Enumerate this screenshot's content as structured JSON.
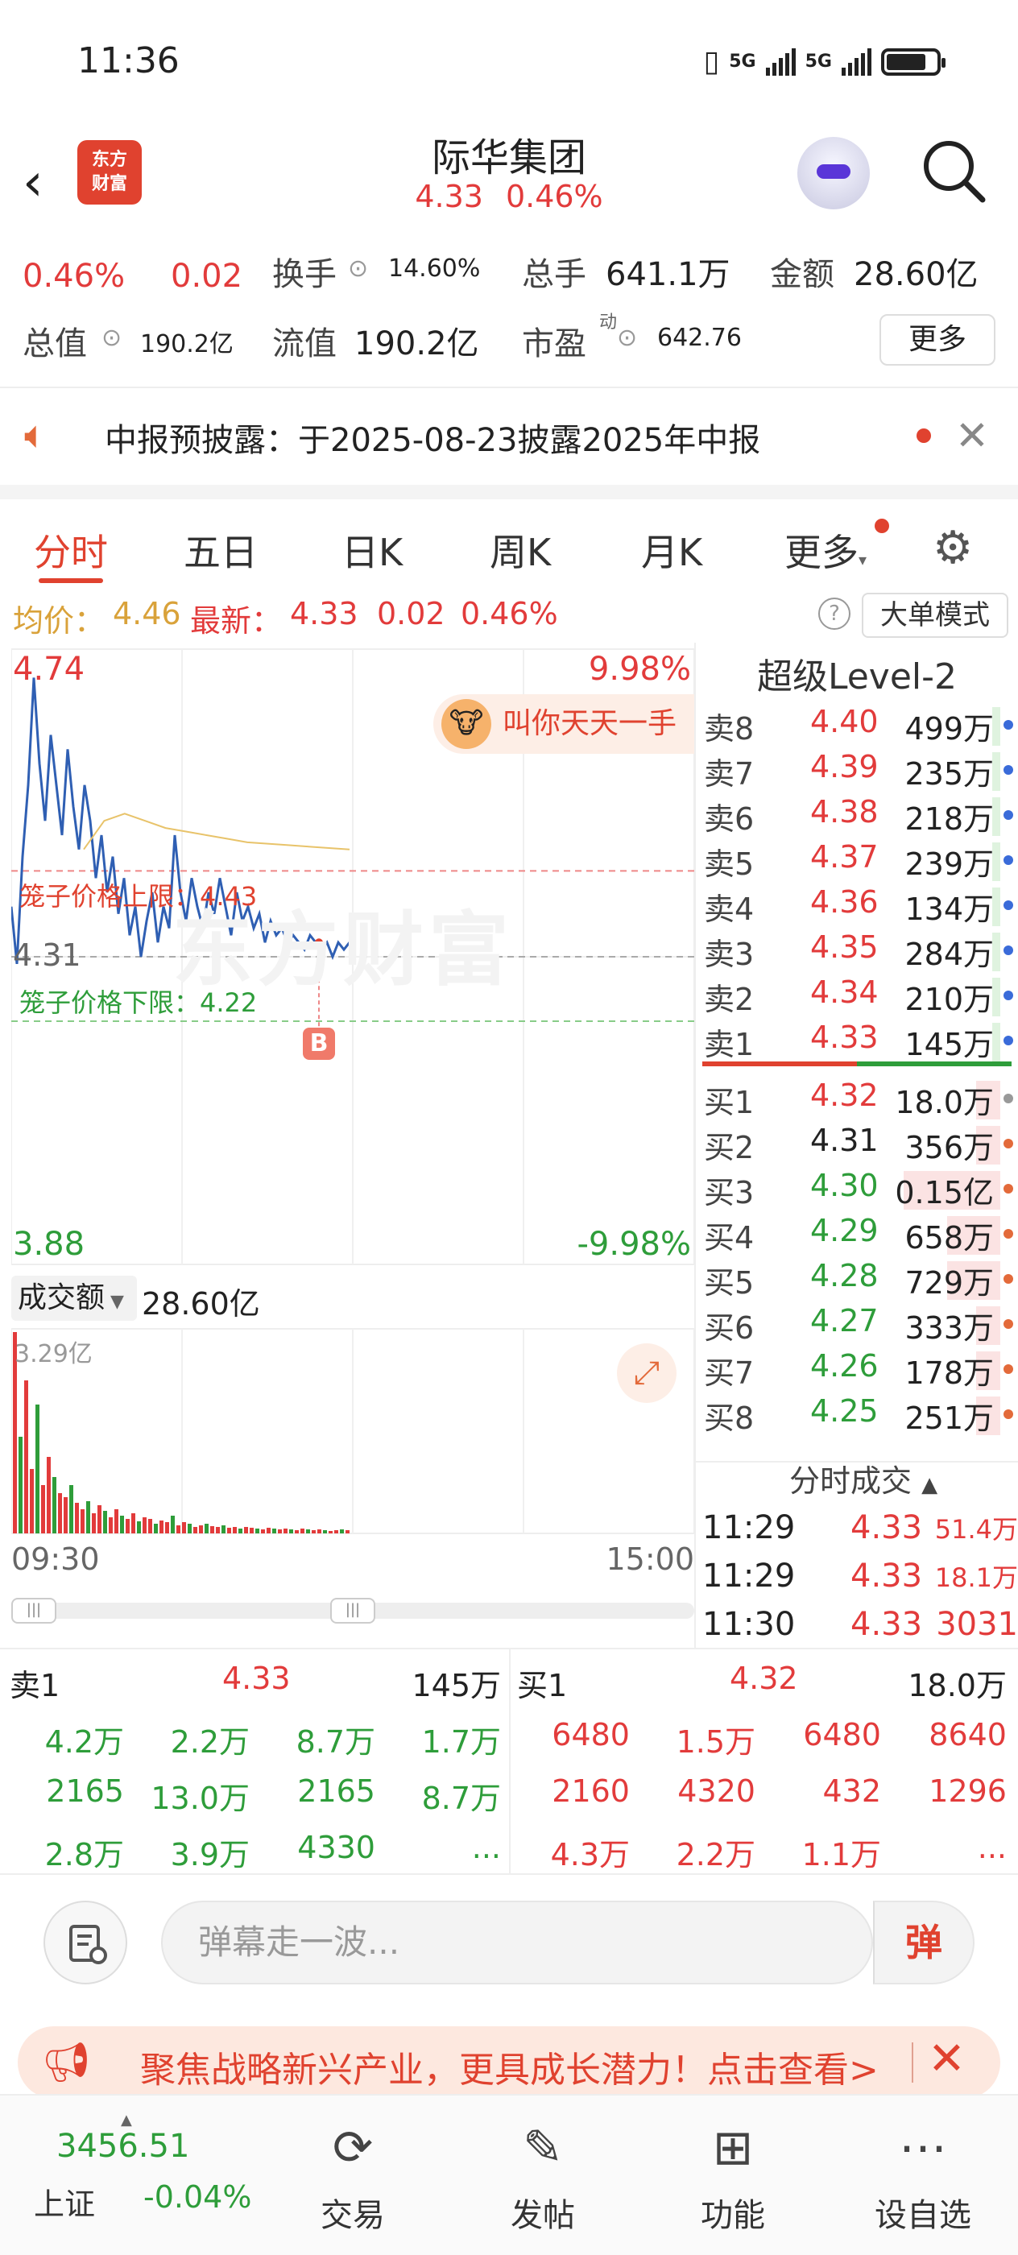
{
  "status": {
    "time": "11:36",
    "net1": "5G",
    "net2": "5G"
  },
  "header": {
    "back": "‹",
    "logo": "东方\n财富",
    "name": "际华集团",
    "price": "4.33",
    "change_pct": "0.46%"
  },
  "quote": {
    "change_pct": "0.46%",
    "change": "0.02",
    "turnover_label": "换手",
    "turnover": "14.60%",
    "volume_label": "总手",
    "volume": "641.1万",
    "amount_label": "金额",
    "amount": "28.60亿",
    "mcap_label": "总值",
    "mcap": "190.2亿",
    "float_label": "流值",
    "float_cap": "190.2亿",
    "pe_label": "市盈",
    "pe_sup": "动",
    "pe": "642.76",
    "more": "更多"
  },
  "notice": {
    "text": "中报预披露：于2025-08-23披露2025年中报"
  },
  "tabs": [
    "分时",
    "五日",
    "日K",
    "周K",
    "月K",
    "更多"
  ],
  "info": {
    "avg_label": "均价：",
    "avg": "4.46",
    "last_label": "最新：",
    "last": "4.33",
    "chg": "0.02",
    "chg_pct": "0.46%",
    "mode": "大单模式"
  },
  "chart": {
    "y_top": "4.74",
    "y_bottom": "3.88",
    "pct_top": "9.98%",
    "pct_bottom": "-9.98%",
    "prev_close": "4.31",
    "cage_upper": "笼子价格上限：4.43",
    "cage_lower": "笼子价格下限：4.22",
    "buy_marker": "B",
    "banner": "叫你天天一手",
    "watermark": "东方财富"
  },
  "chart_data": {
    "type": "line",
    "title": "",
    "x": [
      "09:30",
      "15:00"
    ],
    "ylim": [
      3.88,
      4.74
    ],
    "prev_close": 4.31,
    "series": [
      {
        "name": "最新",
        "color": "#2f5fb3",
        "values": [
          4.38,
          4.3,
          4.45,
          4.55,
          4.7,
          4.58,
          4.5,
          4.62,
          4.55,
          4.48,
          4.6,
          4.52,
          4.46,
          4.55,
          4.5,
          4.42,
          4.48,
          4.4,
          4.45,
          4.37,
          4.42,
          4.34,
          4.38,
          4.31,
          4.36,
          4.4,
          4.33,
          4.38,
          4.35,
          4.48,
          4.4,
          4.36,
          4.42,
          4.38,
          4.35,
          4.4,
          4.37,
          4.42,
          4.38,
          4.34,
          4.4,
          4.36,
          4.38,
          4.35,
          4.37,
          4.33,
          4.36,
          4.34,
          4.35,
          4.33,
          4.34,
          4.33,
          4.32,
          4.34,
          4.33,
          4.32,
          4.33,
          4.31,
          4.33,
          4.32,
          4.33
        ]
      },
      {
        "name": "均价",
        "color": "#e8c36a",
        "values": [
          4.46,
          4.5,
          4.51,
          4.5,
          4.49,
          4.485,
          4.48,
          4.475,
          4.47,
          4.468,
          4.466,
          4.464,
          4.462,
          4.46
        ]
      }
    ],
    "volume": {
      "label": "成交额",
      "total": "28.60亿",
      "max_label": "3.29亿"
    },
    "x_start": "09:30",
    "x_end": "15:00"
  },
  "level2": {
    "title": "超级Level-2",
    "asks": [
      {
        "label": "卖8",
        "price": "4.40",
        "vol": "499万"
      },
      {
        "label": "卖7",
        "price": "4.39",
        "vol": "235万"
      },
      {
        "label": "卖6",
        "price": "4.38",
        "vol": "218万"
      },
      {
        "label": "卖5",
        "price": "4.37",
        "vol": "239万"
      },
      {
        "label": "卖4",
        "price": "4.36",
        "vol": "134万"
      },
      {
        "label": "卖3",
        "price": "4.35",
        "vol": "284万"
      },
      {
        "label": "卖2",
        "price": "4.34",
        "vol": "210万"
      },
      {
        "label": "卖1",
        "price": "4.33",
        "vol": "145万"
      }
    ],
    "bids": [
      {
        "label": "买1",
        "price": "4.32",
        "vol": "18.0万"
      },
      {
        "label": "买2",
        "price": "4.31",
        "vol": "356万"
      },
      {
        "label": "买3",
        "price": "4.30",
        "vol": "0.15亿"
      },
      {
        "label": "买4",
        "price": "4.29",
        "vol": "658万"
      },
      {
        "label": "买5",
        "price": "4.28",
        "vol": "729万"
      },
      {
        "label": "买6",
        "price": "4.27",
        "vol": "333万"
      },
      {
        "label": "买7",
        "price": "4.26",
        "vol": "178万"
      },
      {
        "label": "买8",
        "price": "4.25",
        "vol": "251万"
      }
    ],
    "trades_title": "分时成交",
    "trades": [
      {
        "time": "11:29",
        "price": "4.33",
        "vol": "51.4万"
      },
      {
        "time": "11:29",
        "price": "4.33",
        "vol": "18.1万"
      },
      {
        "time": "11:30",
        "price": "4.33",
        "vol": "3031"
      }
    ]
  },
  "book": {
    "sell_label": "卖1",
    "sell_price": "4.33",
    "sell_vol": "145万",
    "buy_label": "买1",
    "buy_price": "4.32",
    "buy_vol": "18.0万",
    "sell_rows": [
      [
        "4.2万",
        "2.2万",
        "8.7万",
        "1.7万"
      ],
      [
        "2165",
        "13.0万",
        "2165",
        "8.7万"
      ],
      [
        "2.8万",
        "3.9万",
        "4330",
        "..."
      ]
    ],
    "buy_rows": [
      [
        "6480",
        "1.5万",
        "6480",
        "8640"
      ],
      [
        "2160",
        "4320",
        "432",
        "1296"
      ],
      [
        "4.3万",
        "2.2万",
        "1.1万",
        "..."
      ]
    ]
  },
  "danmu": {
    "placeholder": "弹幕走一波...",
    "button": "弹"
  },
  "promo": {
    "text": "聚焦战略新兴产业，更具成长潜力！点击查看>"
  },
  "nav": {
    "index_value": "3456.51",
    "index_name": "上证",
    "index_change": "-0.04%",
    "items": [
      "交易",
      "发帖",
      "功能",
      "设自选"
    ]
  }
}
